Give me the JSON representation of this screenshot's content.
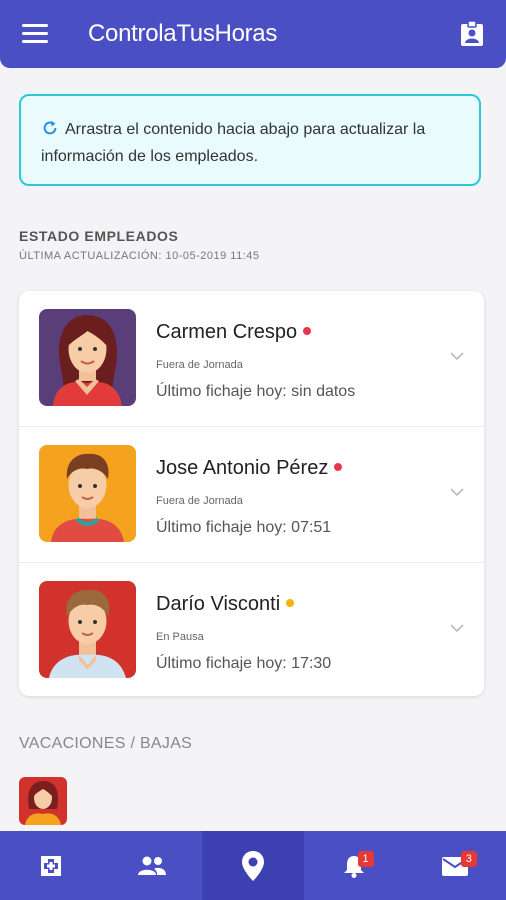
{
  "header": {
    "title": "ControlaTusHoras",
    "menu_icon": "menu-icon",
    "right_icon": "contact-badge-icon"
  },
  "info": {
    "text": "Arrastra el contenido hacia abajo para actualizar la información de los empleados.",
    "icon": "refresh-icon"
  },
  "section": {
    "title": "ESTADO EMPLEADOS",
    "subtitle": "ÚLTIMA ACTUALIZACIÓN: 10-05-2019 11:45"
  },
  "employees": [
    {
      "name": "Carmen Crespo",
      "status": "Fuera de Jornada",
      "last": "Último fichaje hoy: sin datos",
      "dot_color": "#e8364f"
    },
    {
      "name": "Jose Antonio Pérez",
      "status": "Fuera de Jornada",
      "last": "Último fichaje hoy: 07:51",
      "dot_color": "#e8364f"
    },
    {
      "name": "Darío Visconti",
      "status": "En Pausa",
      "last": "Último fichaje hoy: 17:30",
      "dot_color": "#f5b400"
    }
  ],
  "vacations": {
    "title": "VACACIONES / BAJAS"
  },
  "tabs": [
    {
      "icon": "hospital-icon",
      "badge": ""
    },
    {
      "icon": "users-icon",
      "badge": ""
    },
    {
      "icon": "location-pin-icon",
      "badge": ""
    },
    {
      "icon": "bell-icon",
      "badge": "1"
    },
    {
      "icon": "mail-icon",
      "badge": "3"
    }
  ],
  "colors": {
    "primary": "#4a4fc4",
    "info_border": "#2ec7d6",
    "info_bg": "#e9fbfd"
  }
}
